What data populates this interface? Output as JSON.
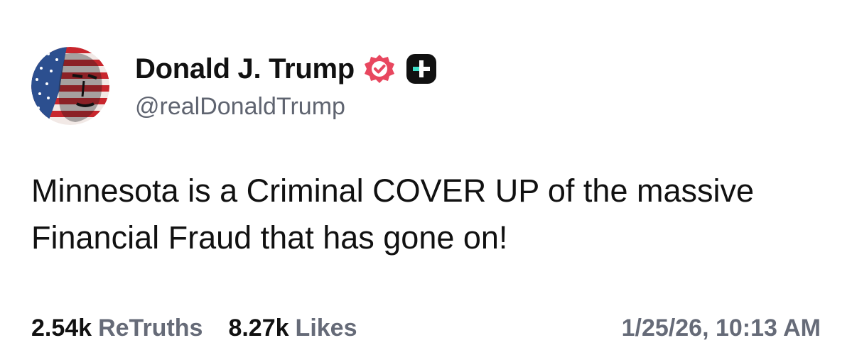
{
  "author": {
    "display_name": "Donald J. Trump",
    "handle": "@realDonaldTrump",
    "avatar_icon": "flag-portrait-avatar",
    "verified_icon": "verified-badge-icon",
    "plus_icon": "plus-badge-icon",
    "verified_color": "#e8475f",
    "plus_badge_color": "#111111",
    "plus_accent_color": "#3ee0c9"
  },
  "post": {
    "text": "Minnesota is a Criminal COVER UP of the massive Financial Fraud that has gone on!"
  },
  "stats": {
    "retruths_count": "2.54k",
    "retruths_label": "ReTruths",
    "likes_count": "8.27k",
    "likes_label": "Likes"
  },
  "timestamp": "1/25/26, 10:13 AM"
}
